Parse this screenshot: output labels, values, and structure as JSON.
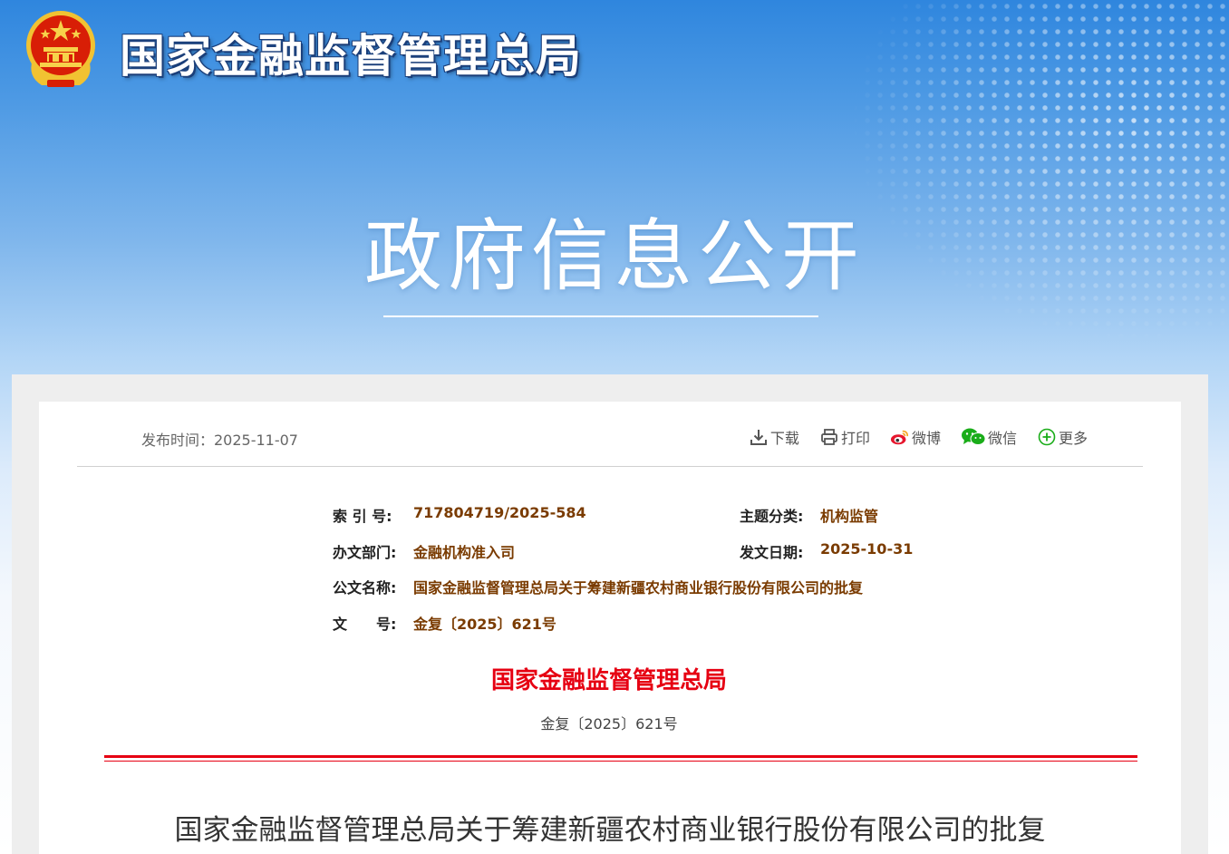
{
  "header": {
    "site_title": "国家金融监督管理总局",
    "banner_title": "政府信息公开"
  },
  "article": {
    "publish_label": "发布时间：2025-11-07",
    "toolbar": {
      "download": "下载",
      "print": "打印",
      "weibo": "微博",
      "wechat": "微信",
      "more": "更多"
    },
    "meta": {
      "index_label": "索 引 号:",
      "index_value": "717804719/2025-584",
      "topic_label": "主题分类:",
      "topic_value": "机构监管",
      "dept_label": "办文部门:",
      "dept_value": "金融机构准入司",
      "date_label": "发文日期:",
      "date_value": "2025-10-31",
      "name_label": "公文名称:",
      "name_value": "国家金融监督管理总局关于筹建新疆农村商业银行股份有限公司的批复",
      "docno_label": "文　　号:",
      "docno_value": "金复〔2025〕621号"
    },
    "agency": "国家金融监督管理总局",
    "doc_number": "金复〔2025〕621号",
    "title": "国家金融监督管理总局关于筹建新疆农村商业银行股份有限公司的批复"
  },
  "icons": {
    "emblem": "national-emblem-icon",
    "download": "download-icon",
    "print": "printer-icon",
    "weibo": "weibo-icon",
    "wechat": "wechat-icon",
    "more": "plus-circle-icon"
  },
  "colors": {
    "banner_blue": "#2f86de",
    "agency_red": "#e60012",
    "meta_value_brown": "#7a3b00",
    "wechat_green": "#1aad19",
    "weibo_red": "#e6162d"
  }
}
